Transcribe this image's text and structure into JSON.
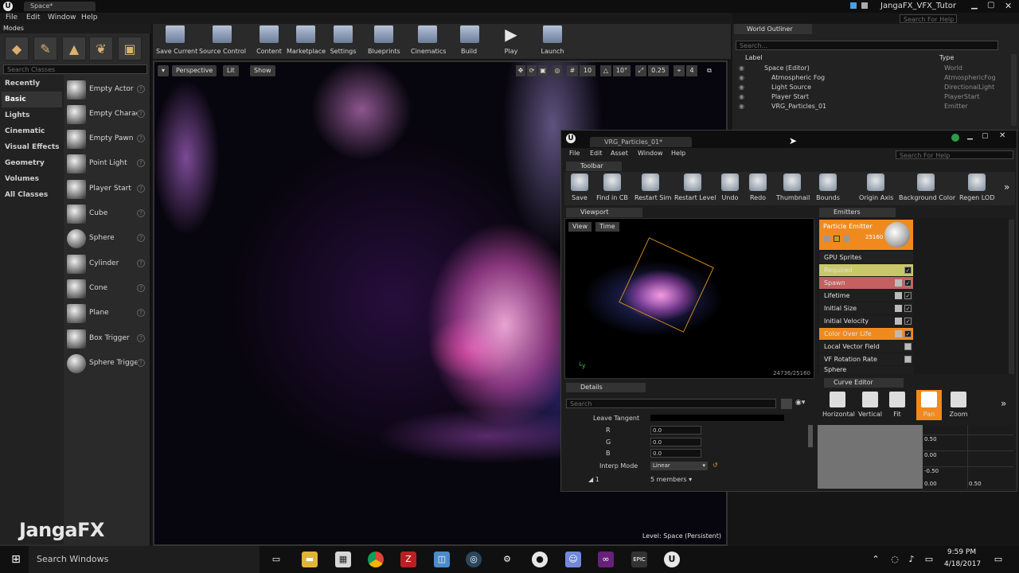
{
  "window": {
    "tab_title": "Space*",
    "project_name": "JangaFX_VFX_Tutor",
    "search_help_placeholder": "Search For Help"
  },
  "menu": [
    "File",
    "Edit",
    "Window",
    "Help"
  ],
  "modes": {
    "tab_label": "Modes",
    "search_placeholder": "Search Classes",
    "categories": [
      "Recently Placed",
      "Basic",
      "Lights",
      "Cinematic",
      "Visual Effects",
      "Geometry",
      "Volumes",
      "All Classes"
    ],
    "selected_category": "Basic",
    "items": [
      "Empty Actor",
      "Empty Charact",
      "Empty Pawn",
      "Point Light",
      "Player Start",
      "Cube",
      "Sphere",
      "Cylinder",
      "Cone",
      "Plane",
      "Box Trigger",
      "Sphere Trigger"
    ],
    "watermark": "JangaFX"
  },
  "toolbar": [
    "Save Current",
    "Source Control",
    "Content",
    "Marketplace",
    "Settings",
    "Blueprints",
    "Cinematics",
    "Build",
    "Play",
    "Launch"
  ],
  "viewport": {
    "perspective": "Perspective",
    "lit": "Lit",
    "show": "Show",
    "grid_snap": "10",
    "rot_snap": "10°",
    "scale_snap": "0.25",
    "cam_speed": "4",
    "level_label": "Level:  Space (Persistent)"
  },
  "outliner": {
    "tab_label": "World Outliner",
    "search_placeholder": "Search...",
    "col_label": "Label",
    "col_type": "Type",
    "rows": [
      {
        "label": "Space (Editor)",
        "type": "World"
      },
      {
        "label": "Atmospheric Fog",
        "type": "AtmosphericFog"
      },
      {
        "label": "Light Source",
        "type": "DirectionalLight"
      },
      {
        "label": "Player Start",
        "type": "PlayerStart"
      },
      {
        "label": "VRG_Particles_01",
        "type": "Emitter"
      }
    ]
  },
  "cascade": {
    "tab_title": "VRG_Particles_01*",
    "search_help_placeholder": "Search For Help",
    "menu": [
      "File",
      "Edit",
      "Asset",
      "Window",
      "Help"
    ],
    "toolbar_tab": "Toolbar",
    "toolbar": [
      "Save",
      "Find in CB",
      "Restart Sim",
      "Restart Level",
      "Undo",
      "Redo",
      "Thumbnail",
      "Bounds",
      "Origin Axis",
      "Background Color",
      "Regen LOD"
    ],
    "viewport_tab": "Viewport",
    "view_btn": "View",
    "time_btn": "Time",
    "particle_count": "24736/25160",
    "emitters_tab": "Emitters",
    "emitter_name": "Particle Emitter",
    "emitter_count": "25160",
    "emitter_type": "GPU Sprites",
    "modules": [
      "Required",
      "Spawn",
      "Lifetime",
      "Initial Size",
      "Initial Velocity",
      "Color Over Life",
      "Local Vector Field",
      "VF Rotation Rate",
      "Sphere"
    ],
    "details_tab": "Details",
    "details_search": "Search",
    "leave_tangent": "Leave Tangent",
    "r_label": "R",
    "r_value": "0.0",
    "g_label": "G",
    "g_value": "0.0",
    "b_label": "B",
    "b_value": "0.0",
    "interp_label": "Interp Mode",
    "interp_value": "Linear",
    "index_label": "1",
    "members": "5 members",
    "curve_tab": "Curve Editor",
    "curve_buttons": [
      "Horizontal",
      "Vertical",
      "Fit",
      "Pan",
      "Zoom"
    ],
    "curve_labels": [
      "0.50",
      "0.00",
      "-0.50",
      "0.00",
      "0.50"
    ]
  },
  "taskbar": {
    "search": "Search Windows",
    "time": "9:59 PM",
    "date": "4/18/2017"
  },
  "colors": {
    "accent_orange": "#f08a1e",
    "required_yellow": "#c8c86a",
    "spawn_red": "#c46060"
  }
}
